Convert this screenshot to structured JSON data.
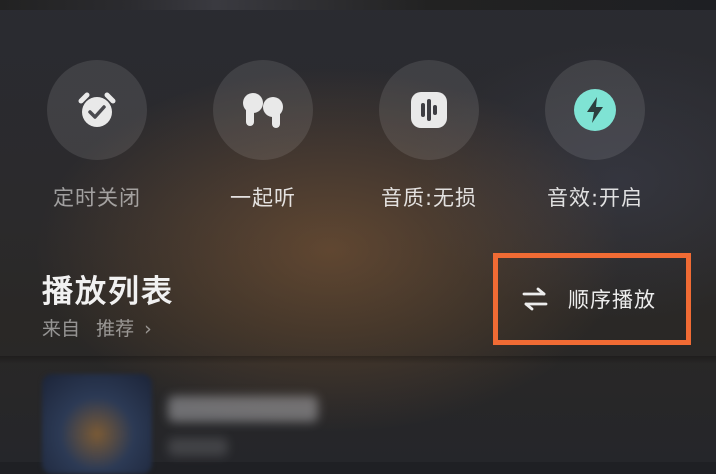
{
  "quick_actions": [
    {
      "icon": "alarm-clock-icon",
      "label": "定时关闭"
    },
    {
      "icon": "earbuds-icon",
      "label": "一起听"
    },
    {
      "icon": "audio-wave-icon",
      "label": "音质:无损"
    },
    {
      "icon": "lightning-icon",
      "label": "音效:开启"
    }
  ],
  "playlist": {
    "title": "播放列表",
    "source_label": "来自",
    "source_value": "推荐",
    "chevron": "›",
    "mode_icon": "arrows-exchange-icon",
    "mode_label": "顺序播放"
  },
  "colors": {
    "highlight_border": "#f06b34",
    "effect_icon_bg": "#7fe3d4"
  }
}
